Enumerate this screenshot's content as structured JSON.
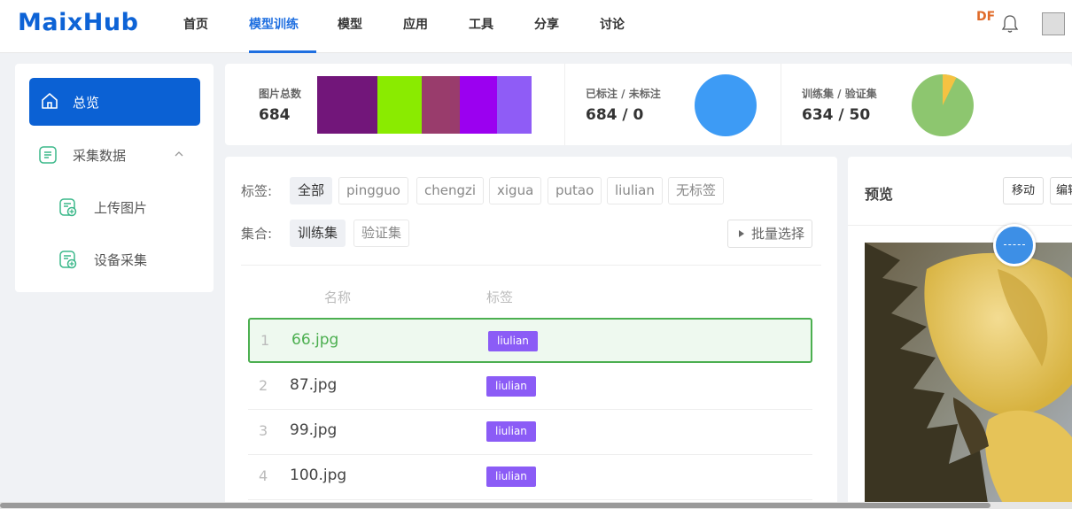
{
  "nav": {
    "logo": "MaixHub",
    "items": [
      "首页",
      "模型训练",
      "模型",
      "应用",
      "工具",
      "分享",
      "讨论"
    ],
    "active_index": 1,
    "badge": "DF",
    "accent": "#1f6fe0"
  },
  "sidebar": {
    "overview": "总览",
    "collect": "采集数据",
    "upload": "上传图片",
    "device": "设备采集"
  },
  "stats": {
    "images_label": "图片总数",
    "images_value": "684",
    "label_colors": [
      "#72167a",
      "#8aeb00",
      "#993c6c",
      "#9b00f0",
      "#8f5cf6"
    ],
    "annotated_label": "已标注 / 未标注",
    "annotated_value": "684 / 0",
    "annotated_fraction": 1.0,
    "split_label": "训练集 / 验证集",
    "split_value": "634 / 50",
    "train_fraction": 0.927,
    "pie_colors": {
      "primary": "#3d9bf5",
      "train": "#8dc66f",
      "val": "#f5c242"
    }
  },
  "filters": {
    "tag_label": "标签:",
    "tags": [
      "全部",
      "pingguo",
      "chengzi",
      "xigua",
      "putao",
      "liulian",
      "无标签"
    ],
    "set_label": "集合:",
    "sets": [
      "训练集",
      "验证集"
    ],
    "batch": "批量选择"
  },
  "table": {
    "col_name": "名称",
    "col_label": "标签",
    "rows": [
      {
        "idx": "1",
        "name": "66.jpg",
        "label": "liulian"
      },
      {
        "idx": "2",
        "name": "87.jpg",
        "label": "liulian"
      },
      {
        "idx": "3",
        "name": "99.jpg",
        "label": "liulian"
      },
      {
        "idx": "4",
        "name": "100.jpg",
        "label": "liulian"
      }
    ]
  },
  "preview": {
    "title": "预览",
    "move": "移动",
    "edit": "编辑"
  }
}
